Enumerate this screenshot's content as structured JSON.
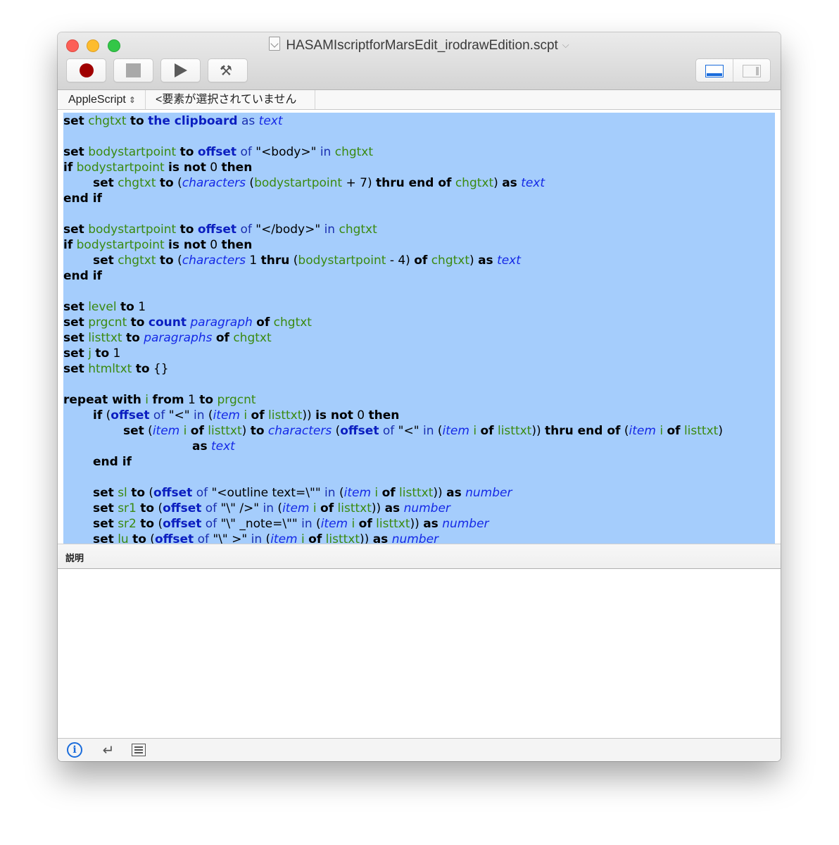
{
  "window": {
    "title": "HASAMIscriptforMarsEdit_irodrawEdition.scpt",
    "title_chevron": "⌵"
  },
  "toolbar": {
    "record_label": "Record",
    "stop_label": "Stop",
    "run_label": "Run",
    "compile_label": "Compile",
    "hammer_glyph": "⚒",
    "view_toggle": [
      "Show log pane",
      "Show sidebar"
    ]
  },
  "navbar": {
    "language": "AppleScript",
    "element": "<要素が選択されていません>",
    "arrows": "⌃⌄"
  },
  "colors": {
    "selection": "#a5cdfc",
    "keyword": "#000000",
    "app_keyword": "#0b1ec0",
    "variable": "#3a8a10",
    "class": "#1428e6",
    "accent": "#1a6cdb"
  },
  "code": [
    {
      "indent": 0,
      "tokens": [
        [
          "kw",
          "set"
        ],
        [
          "txt",
          " "
        ],
        [
          "var",
          "chgtxt"
        ],
        [
          "txt",
          " "
        ],
        [
          "kw",
          "to"
        ],
        [
          "txt",
          " "
        ],
        [
          "ap",
          "the clipboard"
        ],
        [
          "txt",
          " "
        ],
        [
          "prm",
          "as"
        ],
        [
          "txt",
          " "
        ],
        [
          "cls",
          "text"
        ]
      ]
    },
    {
      "indent": 0,
      "tokens": []
    },
    {
      "indent": 0,
      "tokens": [
        [
          "kw",
          "set"
        ],
        [
          "txt",
          " "
        ],
        [
          "var",
          "bodystartpoint"
        ],
        [
          "txt",
          " "
        ],
        [
          "kw",
          "to"
        ],
        [
          "txt",
          " "
        ],
        [
          "ap",
          "offset"
        ],
        [
          "txt",
          " "
        ],
        [
          "prm",
          "of"
        ],
        [
          "txt",
          " \"<body>\" "
        ],
        [
          "prm",
          "in"
        ],
        [
          "txt",
          " "
        ],
        [
          "var",
          "chgtxt"
        ]
      ]
    },
    {
      "indent": 0,
      "tokens": [
        [
          "kw",
          "if"
        ],
        [
          "txt",
          " "
        ],
        [
          "var",
          "bodystartpoint"
        ],
        [
          "txt",
          " "
        ],
        [
          "kw",
          "is not"
        ],
        [
          "txt",
          " 0 "
        ],
        [
          "kw",
          "then"
        ]
      ]
    },
    {
      "indent": 1,
      "tokens": [
        [
          "kw",
          "set"
        ],
        [
          "txt",
          " "
        ],
        [
          "var",
          "chgtxt"
        ],
        [
          "txt",
          " "
        ],
        [
          "kw",
          "to"
        ],
        [
          "txt",
          " ("
        ],
        [
          "cls",
          "characters"
        ],
        [
          "txt",
          " ("
        ],
        [
          "var",
          "bodystartpoint"
        ],
        [
          "txt",
          " + 7) "
        ],
        [
          "kw",
          "thru end of"
        ],
        [
          "txt",
          " "
        ],
        [
          "var",
          "chgtxt"
        ],
        [
          "txt",
          ") "
        ],
        [
          "kw",
          "as"
        ],
        [
          "txt",
          " "
        ],
        [
          "cls",
          "text"
        ]
      ]
    },
    {
      "indent": 0,
      "tokens": [
        [
          "kw",
          "end if"
        ]
      ]
    },
    {
      "indent": 0,
      "tokens": []
    },
    {
      "indent": 0,
      "tokens": [
        [
          "kw",
          "set"
        ],
        [
          "txt",
          " "
        ],
        [
          "var",
          "bodystartpoint"
        ],
        [
          "txt",
          " "
        ],
        [
          "kw",
          "to"
        ],
        [
          "txt",
          " "
        ],
        [
          "ap",
          "offset"
        ],
        [
          "txt",
          " "
        ],
        [
          "prm",
          "of"
        ],
        [
          "txt",
          " \"</body>\" "
        ],
        [
          "prm",
          "in"
        ],
        [
          "txt",
          " "
        ],
        [
          "var",
          "chgtxt"
        ]
      ]
    },
    {
      "indent": 0,
      "tokens": [
        [
          "kw",
          "if"
        ],
        [
          "txt",
          " "
        ],
        [
          "var",
          "bodystartpoint"
        ],
        [
          "txt",
          " "
        ],
        [
          "kw",
          "is not"
        ],
        [
          "txt",
          " 0 "
        ],
        [
          "kw",
          "then"
        ]
      ]
    },
    {
      "indent": 1,
      "tokens": [
        [
          "kw",
          "set"
        ],
        [
          "txt",
          " "
        ],
        [
          "var",
          "chgtxt"
        ],
        [
          "txt",
          " "
        ],
        [
          "kw",
          "to"
        ],
        [
          "txt",
          " ("
        ],
        [
          "cls",
          "characters"
        ],
        [
          "txt",
          " 1 "
        ],
        [
          "kw",
          "thru"
        ],
        [
          "txt",
          " ("
        ],
        [
          "var",
          "bodystartpoint"
        ],
        [
          "txt",
          " - 4) "
        ],
        [
          "kw",
          "of"
        ],
        [
          "txt",
          " "
        ],
        [
          "var",
          "chgtxt"
        ],
        [
          "txt",
          ") "
        ],
        [
          "kw",
          "as"
        ],
        [
          "txt",
          " "
        ],
        [
          "cls",
          "text"
        ]
      ]
    },
    {
      "indent": 0,
      "tokens": [
        [
          "kw",
          "end if"
        ]
      ]
    },
    {
      "indent": 0,
      "tokens": []
    },
    {
      "indent": 0,
      "tokens": [
        [
          "kw",
          "set"
        ],
        [
          "txt",
          " "
        ],
        [
          "var",
          "level"
        ],
        [
          "txt",
          " "
        ],
        [
          "kw",
          "to"
        ],
        [
          "txt",
          " 1"
        ]
      ]
    },
    {
      "indent": 0,
      "tokens": [
        [
          "kw",
          "set"
        ],
        [
          "txt",
          " "
        ],
        [
          "var",
          "prgcnt"
        ],
        [
          "txt",
          " "
        ],
        [
          "kw",
          "to"
        ],
        [
          "txt",
          " "
        ],
        [
          "ap",
          "count"
        ],
        [
          "txt",
          " "
        ],
        [
          "cls",
          "paragraph"
        ],
        [
          "txt",
          " "
        ],
        [
          "kw",
          "of"
        ],
        [
          "txt",
          " "
        ],
        [
          "var",
          "chgtxt"
        ]
      ]
    },
    {
      "indent": 0,
      "tokens": [
        [
          "kw",
          "set"
        ],
        [
          "txt",
          " "
        ],
        [
          "var",
          "listtxt"
        ],
        [
          "txt",
          " "
        ],
        [
          "kw",
          "to"
        ],
        [
          "txt",
          " "
        ],
        [
          "cls",
          "paragraphs"
        ],
        [
          "txt",
          " "
        ],
        [
          "kw",
          "of"
        ],
        [
          "txt",
          " "
        ],
        [
          "var",
          "chgtxt"
        ]
      ]
    },
    {
      "indent": 0,
      "tokens": [
        [
          "kw",
          "set"
        ],
        [
          "txt",
          " "
        ],
        [
          "var",
          "j"
        ],
        [
          "txt",
          " "
        ],
        [
          "kw",
          "to"
        ],
        [
          "txt",
          " 1"
        ]
      ]
    },
    {
      "indent": 0,
      "tokens": [
        [
          "kw",
          "set"
        ],
        [
          "txt",
          " "
        ],
        [
          "var",
          "htmltxt"
        ],
        [
          "txt",
          " "
        ],
        [
          "kw",
          "to"
        ],
        [
          "txt",
          " {}"
        ]
      ]
    },
    {
      "indent": 0,
      "tokens": []
    },
    {
      "indent": 0,
      "tokens": [
        [
          "kw",
          "repeat with"
        ],
        [
          "txt",
          " "
        ],
        [
          "var",
          "i"
        ],
        [
          "txt",
          " "
        ],
        [
          "kw",
          "from"
        ],
        [
          "txt",
          " 1 "
        ],
        [
          "kw",
          "to"
        ],
        [
          "txt",
          " "
        ],
        [
          "var",
          "prgcnt"
        ]
      ]
    },
    {
      "indent": 1,
      "tokens": [
        [
          "kw",
          "if"
        ],
        [
          "txt",
          " ("
        ],
        [
          "ap",
          "offset"
        ],
        [
          "txt",
          " "
        ],
        [
          "prm",
          "of"
        ],
        [
          "txt",
          " \"<\" "
        ],
        [
          "prm",
          "in"
        ],
        [
          "txt",
          " ("
        ],
        [
          "cls",
          "item"
        ],
        [
          "txt",
          " "
        ],
        [
          "var",
          "i"
        ],
        [
          "txt",
          " "
        ],
        [
          "kw",
          "of"
        ],
        [
          "txt",
          " "
        ],
        [
          "var",
          "listtxt"
        ],
        [
          "txt",
          "))"
        ],
        [
          "txt",
          " "
        ],
        [
          "kw",
          "is not"
        ],
        [
          "txt",
          " 0 "
        ],
        [
          "kw",
          "then"
        ]
      ]
    },
    {
      "indent": 2,
      "tokens": [
        [
          "kw",
          "set"
        ],
        [
          "txt",
          " ("
        ],
        [
          "cls",
          "item"
        ],
        [
          "txt",
          " "
        ],
        [
          "var",
          "i"
        ],
        [
          "txt",
          " "
        ],
        [
          "kw",
          "of"
        ],
        [
          "txt",
          " "
        ],
        [
          "var",
          "listtxt"
        ],
        [
          "txt",
          ") "
        ],
        [
          "kw",
          "to"
        ],
        [
          "txt",
          " "
        ],
        [
          "cls",
          "characters"
        ],
        [
          "txt",
          " ("
        ],
        [
          "ap",
          "offset"
        ],
        [
          "txt",
          " "
        ],
        [
          "prm",
          "of"
        ],
        [
          "txt",
          " \"<\" "
        ],
        [
          "prm",
          "in"
        ],
        [
          "txt",
          " ("
        ],
        [
          "cls",
          "item"
        ],
        [
          "txt",
          " "
        ],
        [
          "var",
          "i"
        ],
        [
          "txt",
          " "
        ],
        [
          "kw",
          "of"
        ],
        [
          "txt",
          " "
        ],
        [
          "var",
          "listtxt"
        ],
        [
          "txt",
          "))"
        ],
        [
          "txt",
          " "
        ],
        [
          "kw",
          "thru end of"
        ],
        [
          "txt",
          " ("
        ],
        [
          "cls",
          "item"
        ],
        [
          "txt",
          " "
        ],
        [
          "var",
          "i"
        ],
        [
          "txt",
          " "
        ],
        [
          "kw",
          "of"
        ],
        [
          "txt",
          " "
        ],
        [
          "var",
          "listtxt"
        ],
        [
          "txt",
          ")"
        ]
      ]
    },
    {
      "indent": 3,
      "tokens": [
        [
          "kw",
          "as"
        ],
        [
          "txt",
          " "
        ],
        [
          "cls",
          "text"
        ]
      ]
    },
    {
      "indent": 1,
      "tokens": [
        [
          "kw",
          "end if"
        ]
      ]
    },
    {
      "indent": 0,
      "tokens": []
    },
    {
      "indent": 1,
      "tokens": [
        [
          "kw",
          "set"
        ],
        [
          "txt",
          " "
        ],
        [
          "var",
          "sl"
        ],
        [
          "txt",
          " "
        ],
        [
          "kw",
          "to"
        ],
        [
          "txt",
          " ("
        ],
        [
          "ap",
          "offset"
        ],
        [
          "txt",
          " "
        ],
        [
          "prm",
          "of"
        ],
        [
          "txt",
          " \"<outline text=\\\"\" "
        ],
        [
          "prm",
          "in"
        ],
        [
          "txt",
          " ("
        ],
        [
          "cls",
          "item"
        ],
        [
          "txt",
          " "
        ],
        [
          "var",
          "i"
        ],
        [
          "txt",
          " "
        ],
        [
          "kw",
          "of"
        ],
        [
          "txt",
          " "
        ],
        [
          "var",
          "listtxt"
        ],
        [
          "txt",
          "))"
        ],
        [
          "txt",
          " "
        ],
        [
          "kw",
          "as"
        ],
        [
          "txt",
          " "
        ],
        [
          "cls",
          "number"
        ]
      ]
    },
    {
      "indent": 1,
      "tokens": [
        [
          "kw",
          "set"
        ],
        [
          "txt",
          " "
        ],
        [
          "var",
          "sr1"
        ],
        [
          "txt",
          " "
        ],
        [
          "kw",
          "to"
        ],
        [
          "txt",
          " ("
        ],
        [
          "ap",
          "offset"
        ],
        [
          "txt",
          " "
        ],
        [
          "prm",
          "of"
        ],
        [
          "txt",
          " \"\\\" />\" "
        ],
        [
          "prm",
          "in"
        ],
        [
          "txt",
          " ("
        ],
        [
          "cls",
          "item"
        ],
        [
          "txt",
          " "
        ],
        [
          "var",
          "i"
        ],
        [
          "txt",
          " "
        ],
        [
          "kw",
          "of"
        ],
        [
          "txt",
          " "
        ],
        [
          "var",
          "listtxt"
        ],
        [
          "txt",
          "))"
        ],
        [
          "txt",
          " "
        ],
        [
          "kw",
          "as"
        ],
        [
          "txt",
          " "
        ],
        [
          "cls",
          "number"
        ]
      ]
    },
    {
      "indent": 1,
      "tokens": [
        [
          "kw",
          "set"
        ],
        [
          "txt",
          " "
        ],
        [
          "var",
          "sr2"
        ],
        [
          "txt",
          " "
        ],
        [
          "kw",
          "to"
        ],
        [
          "txt",
          " ("
        ],
        [
          "ap",
          "offset"
        ],
        [
          "txt",
          " "
        ],
        [
          "prm",
          "of"
        ],
        [
          "txt",
          " \"\\\" _note=\\\"\" "
        ],
        [
          "prm",
          "in"
        ],
        [
          "txt",
          " ("
        ],
        [
          "cls",
          "item"
        ],
        [
          "txt",
          " "
        ],
        [
          "var",
          "i"
        ],
        [
          "txt",
          " "
        ],
        [
          "kw",
          "of"
        ],
        [
          "txt",
          " "
        ],
        [
          "var",
          "listtxt"
        ],
        [
          "txt",
          "))"
        ],
        [
          "txt",
          " "
        ],
        [
          "kw",
          "as"
        ],
        [
          "txt",
          " "
        ],
        [
          "cls",
          "number"
        ]
      ]
    },
    {
      "indent": 1,
      "tokens": [
        [
          "kw",
          "set"
        ],
        [
          "txt",
          " "
        ],
        [
          "var",
          "lu"
        ],
        [
          "txt",
          " "
        ],
        [
          "kw",
          "to"
        ],
        [
          "txt",
          " ("
        ],
        [
          "ap",
          "offset"
        ],
        [
          "txt",
          " "
        ],
        [
          "prm",
          "of"
        ],
        [
          "txt",
          " \"\\\" >\" "
        ],
        [
          "prm",
          "in"
        ],
        [
          "txt",
          " ("
        ],
        [
          "cls",
          "item"
        ],
        [
          "txt",
          " "
        ],
        [
          "var",
          "i"
        ],
        [
          "txt",
          " "
        ],
        [
          "kw",
          "of"
        ],
        [
          "txt",
          " "
        ],
        [
          "var",
          "listtxt"
        ],
        [
          "txt",
          "))"
        ],
        [
          "txt",
          " "
        ],
        [
          "kw",
          "as"
        ],
        [
          "txt",
          " "
        ],
        [
          "cls",
          "number"
        ]
      ]
    }
  ],
  "description_pane": {
    "label": "説明",
    "content": ""
  },
  "bottom_bar": {
    "info_glyph": "i",
    "return_glyph": "↵",
    "items": [
      "Description",
      "Result",
      "Log"
    ]
  }
}
